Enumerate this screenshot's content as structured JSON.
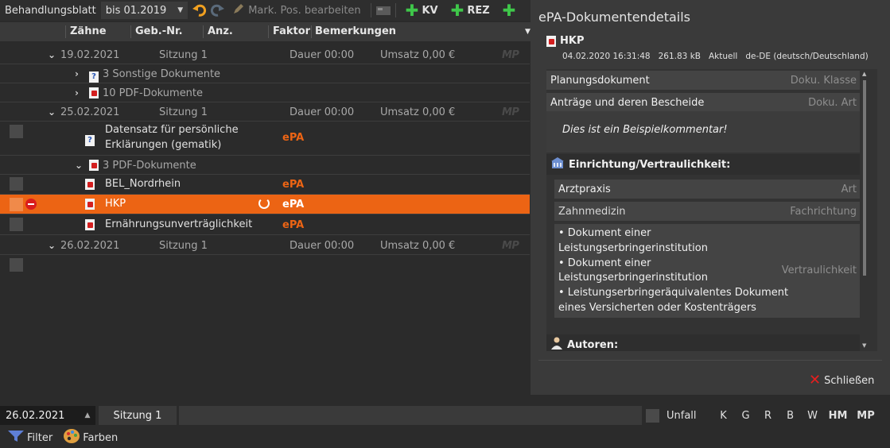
{
  "toolbar": {
    "view_label": "Behandlungsblatt",
    "period_select": "bis 01.2019",
    "edit_positions": "Mark. Pos. bearbeiten",
    "kv_label": "KV",
    "rez_label": "REZ"
  },
  "grid": {
    "columns": {
      "teeth": "Zähne",
      "fee_no": "Geb.-Nr.",
      "count": "Anz.",
      "factor": "Faktor",
      "remarks": "Bemerkungen"
    },
    "session_1": {
      "date": "19.02.2021",
      "session": "Sitzung 1",
      "duration": "Dauer 00:00",
      "revenue": "Umsatz 0,00 €",
      "mp": "MP",
      "groups": [
        "3 Sonstige Dokumente",
        "10 PDF-Dokumente"
      ]
    },
    "session_2": {
      "date": "25.02.2021",
      "session": "Sitzung 1",
      "duration": "Dauer 00:00",
      "revenue": "Umsatz 0,00 €",
      "mp": "MP",
      "item_1_line_1": "Datensatz für persönliche",
      "item_1_line_2": "Erklärungen (gematik)",
      "item_1_tag": "ePA",
      "group": "3 PDF-Dokumente",
      "docs": [
        {
          "name": "BEL_Nordrhein",
          "tag": "ePA"
        },
        {
          "name": "HKP",
          "tag": "ePA"
        },
        {
          "name": "Ernährungsunverträglichkeit",
          "tag": "ePA"
        }
      ]
    },
    "session_3": {
      "date": "26.02.2021",
      "session": "Sitzung 1",
      "duration": "Dauer 00:00",
      "revenue": "Umsatz 0,00 €",
      "mp": "MP"
    }
  },
  "details": {
    "title": "ePA-Dokumentendetails",
    "doc_name": "HKP",
    "meta": {
      "datetime": "04.02.2020 16:31:48",
      "size": "261.83 kB",
      "status": "Aktuell",
      "language": "de-DE (deutsch/Deutschland)"
    },
    "class_value": "Planungsdokument",
    "class_label": "Doku. Klasse",
    "type_value": "Anträge und deren Bescheide",
    "type_label": "Doku. Art",
    "comment": "Dies ist ein Beispielkommentar!",
    "facility_header": "Einrichtung/Vertraulichkeit:",
    "facility_type_value": "Arztpraxis",
    "facility_type_label": "Art",
    "specialty_value": "Zahnmedizin",
    "specialty_label": "Fachrichtung",
    "confidentiality_lines": [
      "• Dokument einer",
      "Leistungserbringerinstitution",
      "• Dokument einer",
      "Leistungserbringerinstitution",
      "• Leistungserbringeräquivalentes Dokument",
      "eines Versicherten oder Kostenträgers"
    ],
    "confidentiality_label": "Vertraulichkeit",
    "authors_header": "Autoren:",
    "close_label": "Schließen"
  },
  "status": {
    "date": "26.02.2021",
    "session": "Sitzung 1",
    "accident_label": "Unfall",
    "letters": [
      "K",
      "G",
      "R",
      "B",
      "W",
      "HM",
      "MP"
    ]
  },
  "bottom": {
    "filter_label": "Filter",
    "colors_label": "Farben"
  },
  "colors": {
    "accent": "#EC6414",
    "epa_tag": "#EC6414",
    "add_green": "#3FC74A",
    "close_red": "#E81E1E"
  }
}
